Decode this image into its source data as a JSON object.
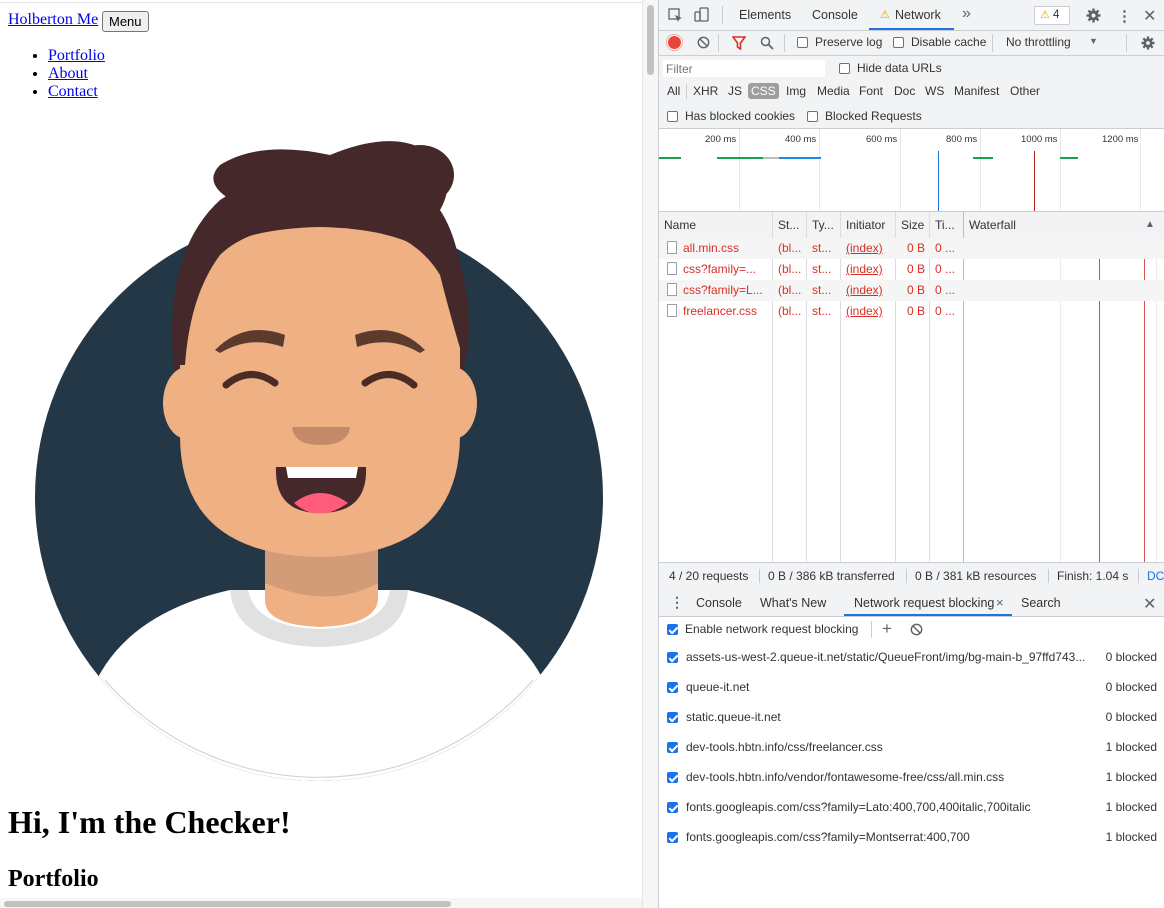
{
  "page": {
    "brand": "Holberton Me",
    "menu_button": "Menu",
    "nav": [
      "Portfolio",
      "About",
      "Contact"
    ],
    "hero_title": "Hi, I'm the Checker!",
    "section_title": "Portfolio"
  },
  "devtools": {
    "tabs": [
      "Elements",
      "Console",
      "Network"
    ],
    "more_tabs": "»",
    "warning_count": "4",
    "toolbar": {
      "preserve_log": "Preserve log",
      "disable_cache": "Disable cache",
      "throttling": "No throttling"
    },
    "filter": {
      "placeholder": "Filter",
      "hide_data_urls": "Hide data URLs",
      "types": [
        "All",
        "XHR",
        "JS",
        "CSS",
        "Img",
        "Media",
        "Font",
        "Doc",
        "WS",
        "Manifest",
        "Other"
      ],
      "active_type": "CSS",
      "has_blocked_cookies": "Has blocked cookies",
      "blocked_requests": "Blocked Requests"
    },
    "overview_ticks": [
      "200 ms",
      "400 ms",
      "600 ms",
      "800 ms",
      "1000 ms",
      "1200 ms"
    ],
    "table": {
      "headers": [
        "Name",
        "St...",
        "Ty...",
        "Initiator",
        "Size",
        "Ti...",
        "Waterfall"
      ],
      "rows": [
        {
          "name": "all.min.css",
          "status": "(bl...",
          "type": "st...",
          "initiator": "(index)",
          "size": "0 B",
          "time": "0 ..."
        },
        {
          "name": "css?family=...",
          "status": "(bl...",
          "type": "st...",
          "initiator": "(index)",
          "size": "0 B",
          "time": "0 ..."
        },
        {
          "name": "css?family=L...",
          "status": "(bl...",
          "type": "st...",
          "initiator": "(index)",
          "size": "0 B",
          "time": "0 ..."
        },
        {
          "name": "freelancer.css",
          "status": "(bl...",
          "type": "st...",
          "initiator": "(index)",
          "size": "0 B",
          "time": "0 ..."
        }
      ]
    },
    "status_bar": {
      "requests": "4 / 20 requests",
      "transferred": "0 B / 386 kB transferred",
      "resources": "0 B / 381 kB resources",
      "finish": "Finish: 1.04 s",
      "dcl": "DC"
    },
    "drawer": {
      "tabs": [
        "Console",
        "What's New",
        "Network request blocking",
        "Search"
      ],
      "active_tab": "Network request blocking",
      "enable_label": "Enable network request blocking",
      "patterns": [
        {
          "pattern": "assets-us-west-2.queue-it.net/static/QueueFront/img/bg-main-b_97ffd743...",
          "count": "0 blocked"
        },
        {
          "pattern": "queue-it.net",
          "count": "0 blocked"
        },
        {
          "pattern": "static.queue-it.net",
          "count": "0 blocked"
        },
        {
          "pattern": "dev-tools.hbtn.info/css/freelancer.css",
          "count": "1 blocked"
        },
        {
          "pattern": "dev-tools.hbtn.info/vendor/fontawesome-free/css/all.min.css",
          "count": "1 blocked"
        },
        {
          "pattern": "fonts.googleapis.com/css?family=Lato:400,700,400italic,700italic",
          "count": "1 blocked"
        },
        {
          "pattern": "fonts.googleapis.com/css?family=Montserrat:400,700",
          "count": "1 blocked"
        }
      ]
    },
    "colors": {
      "accent": "#1a73e8",
      "error_red": "#d93025",
      "record_red": "#e8453c",
      "avatar_bg": "#243746",
      "skin": "#efb083",
      "hair": "#45292a"
    }
  }
}
